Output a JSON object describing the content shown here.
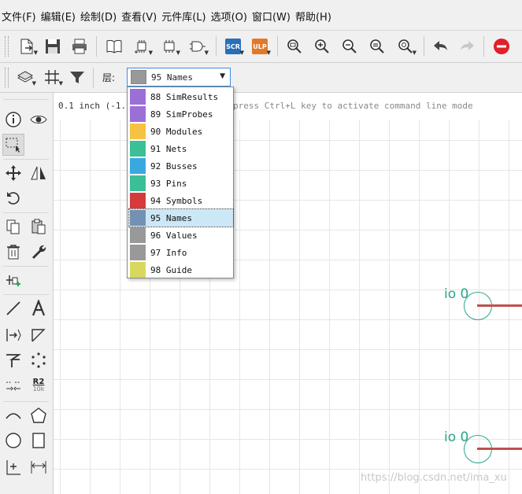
{
  "menu": [
    "文件(F)",
    "编辑(E)",
    "绘制(D)",
    "查看(V)",
    "元件库(L)",
    "选项(O)",
    "窗口(W)",
    "帮助(H)"
  ],
  "toolbar": {
    "scr_label": "SCR",
    "ulp_label": "ULP"
  },
  "layer": {
    "label": "层:",
    "selected": "95 Names",
    "selected_color": "#999999",
    "options": [
      {
        "label": "88 SimResults",
        "color": "#9c6fd6"
      },
      {
        "label": "89 SimProbes",
        "color": "#9c6fd6"
      },
      {
        "label": "90 Modules",
        "color": "#f5c242"
      },
      {
        "label": "91 Nets",
        "color": "#3bbf96"
      },
      {
        "label": "92 Busses",
        "color": "#3aa8e0"
      },
      {
        "label": "93 Pins",
        "color": "#3bbf96"
      },
      {
        "label": "94 Symbols",
        "color": "#d63a3a"
      },
      {
        "label": "95 Names",
        "color": "#7392b3"
      },
      {
        "label": "96 Values",
        "color": "#999999"
      },
      {
        "label": "97 Info",
        "color": "#999999"
      },
      {
        "label": "98 Guide",
        "color": "#d8d860"
      }
    ]
  },
  "canvas": {
    "coord": "0.1 inch (-1.2",
    "cmd_hint": "press Ctrl+L key to activate command line mode",
    "io_labels": [
      "io 0",
      "io 0"
    ]
  },
  "palette": {
    "r2_label": "R2",
    "r2_sub": "10k"
  },
  "watermark": "https://blog.csdn.net/ima_xu"
}
